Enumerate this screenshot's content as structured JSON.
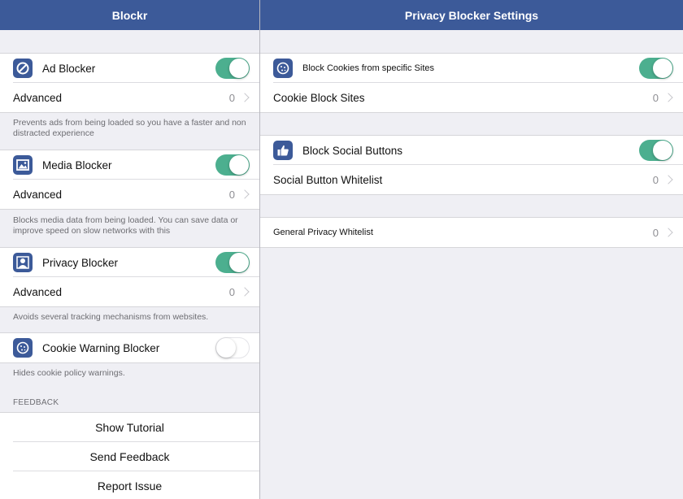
{
  "left": {
    "title": "Blockr",
    "ad_blocker": {
      "label": "Ad Blocker",
      "enabled": true,
      "advanced_label": "Advanced",
      "advanced_count": "0",
      "footer": "Prevents ads from being loaded so you have a faster and non distracted experience"
    },
    "media_blocker": {
      "label": "Media Blocker",
      "enabled": true,
      "advanced_label": "Advanced",
      "advanced_count": "0",
      "footer": "Blocks media data from being loaded. You can save data or improve speed on slow networks with this"
    },
    "privacy_blocker": {
      "label": "Privacy Blocker",
      "enabled": true,
      "advanced_label": "Advanced",
      "advanced_count": "0",
      "footer": "Avoids several tracking mechanisms from websites."
    },
    "cookie_warning_blocker": {
      "label": "Cookie Warning Blocker",
      "enabled": false,
      "footer": "Hides cookie policy warnings."
    },
    "feedback": {
      "header": "FEEDBACK",
      "show_tutorial": "Show Tutorial",
      "send_feedback": "Send Feedback",
      "report_issue": "Report Issue"
    }
  },
  "right": {
    "title": "Privacy Blocker Settings",
    "block_cookies": {
      "label": "Block Cookies from specific Sites",
      "enabled": true
    },
    "cookie_block_sites": {
      "label": "Cookie Block Sites",
      "count": "0"
    },
    "block_social": {
      "label": "Block Social Buttons",
      "enabled": true
    },
    "social_whitelist": {
      "label": "Social Button Whitelist",
      "count": "0"
    },
    "general_whitelist": {
      "label": "General Privacy Whitelist",
      "count": "0"
    }
  },
  "colors": {
    "nav": "#3c5a99",
    "toggle_on": "#4caf8f",
    "background": "#efeff4"
  },
  "icons": [
    "block-icon",
    "image-icon",
    "person-icon",
    "cookie-icon",
    "thumbs-up-icon"
  ]
}
